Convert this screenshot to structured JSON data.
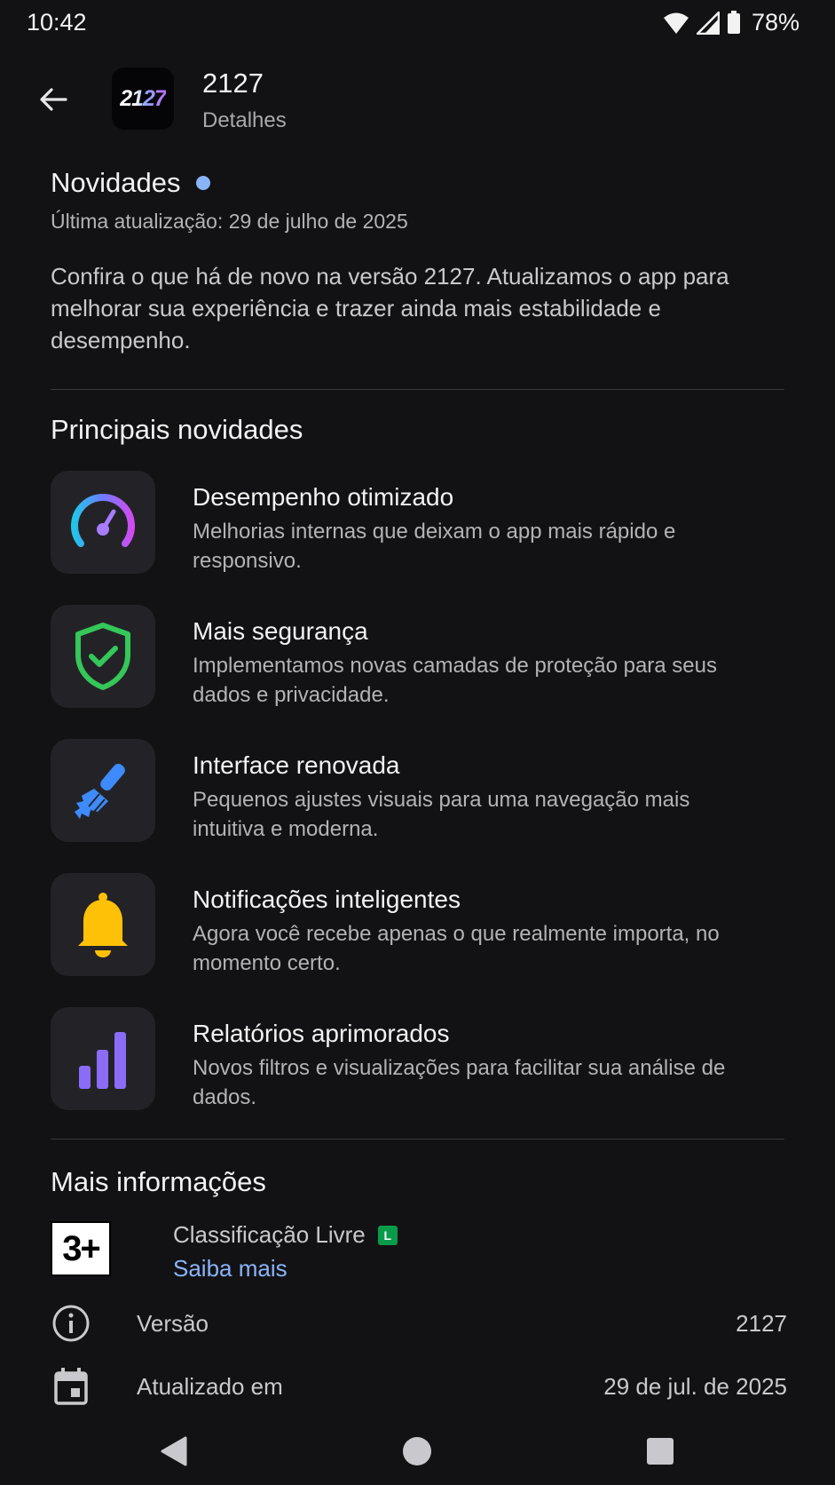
{
  "status_bar": {
    "time": "10:42",
    "battery": "78%"
  },
  "app_bar": {
    "app_icon_text": "2127",
    "title": "2127",
    "subtitle": "Detalhes"
  },
  "whats_new": {
    "title": "Novidades",
    "last_update": "Última atualização: 29 de julho de 2025",
    "description": "Confira o que há de novo na versão 2127. Atualizamos o app para melhorar sua experiência e trazer ainda mais estabilidade e desempenho."
  },
  "highlights": {
    "title": "Principais novidades",
    "items": [
      {
        "icon": "speedometer-icon",
        "title": "Desempenho otimizado",
        "description": "Melhorias internas que deixam o app mais rápido e responsivo."
      },
      {
        "icon": "shield-check-icon",
        "title": "Mais segurança",
        "description": "Implementamos novas camadas de proteção para seus dados e privacidade."
      },
      {
        "icon": "paintbrush-icon",
        "title": "Interface renovada",
        "description": "Pequenos ajustes visuais para uma navegação mais intuitiva e moderna."
      },
      {
        "icon": "bell-icon",
        "title": "Notificações inteligentes",
        "description": "Agora você recebe apenas o que realmente importa, no momento certo."
      },
      {
        "icon": "bar-chart-icon",
        "title": "Relatórios aprimorados",
        "description": "Novos filtros e visualizações para facilitar sua análise de dados."
      }
    ]
  },
  "more_info": {
    "title": "Mais informações",
    "rating_badge": "3+",
    "rating_label": "Classificação Livre",
    "rating_mini_badge": "L",
    "learn_more": "Saiba mais",
    "version_label": "Versão",
    "version_value": "2127",
    "updated_label": "Atualizado em",
    "updated_value": "29 de jul. de 2025"
  },
  "colors": {
    "background": "#121214",
    "accent_link": "#8ab4f8",
    "shield_green": "#34c759",
    "bell_yellow": "#ffc107",
    "brush_blue": "#3d8bff",
    "chart_purple": "#8b6cf6"
  }
}
